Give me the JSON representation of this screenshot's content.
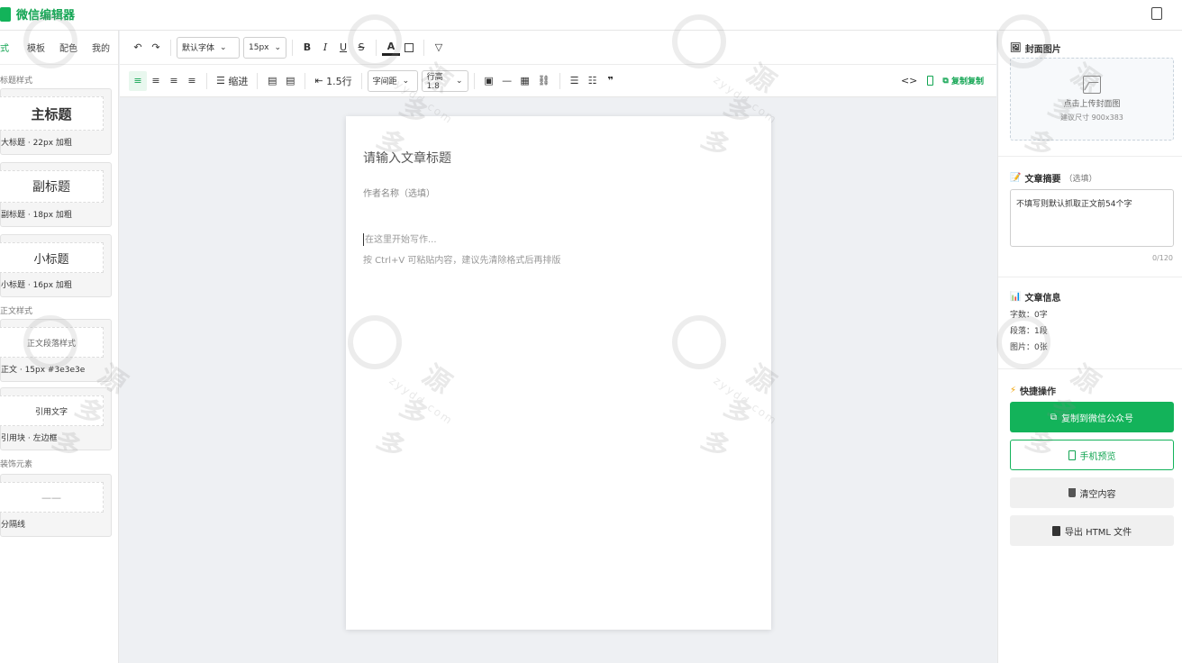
{
  "app": {
    "title": "微信编辑器"
  },
  "left_panel": {
    "tabs": [
      {
        "label": "式",
        "active": true
      },
      {
        "label": "模板"
      },
      {
        "label": "配色"
      },
      {
        "label": "我的"
      }
    ],
    "section_titles": [
      "标题样式",
      "正文样式",
      "装饰元素"
    ],
    "cards": [
      {
        "preview": "主标题",
        "caption": "大标题 · 22px 加粗"
      },
      {
        "preview": "副标题",
        "caption": "副标题 · 18px 加粗"
      },
      {
        "preview": "小标题",
        "caption": "小标题 · 16px 加粗"
      },
      {
        "preview": "正文段落样式",
        "caption": "正文 · 15px #3e3e3e"
      },
      {
        "preview": "引用文字",
        "caption": "引用块 · 左边框"
      },
      {
        "preview": "——",
        "caption": "分隔线"
      }
    ]
  },
  "toolbar1": {
    "undo": "↶",
    "redo": "↷",
    "font_family": "默认字体",
    "font_size": "15px",
    "bold": "B",
    "italic": "I",
    "underline": "U",
    "strike": "S",
    "text_color": "A"
  },
  "toolbar2": {
    "indent_label": "缩进",
    "line_break_label": "1.5行",
    "letter_spacing": "字间距",
    "line_height": "行高1.8",
    "copy_label": "复制复制",
    "code": "<>"
  },
  "editor": {
    "title_placeholder": "请输入文章标题",
    "author_placeholder": "作者名称（选填）",
    "body_placeholder": "在这里开始写作...",
    "tip": "按 Ctrl+V 可粘贴内容，建议先清除格式后再排版"
  },
  "right_panel": {
    "cover": {
      "title": "封面图片",
      "upload_text": "点击上传封面图",
      "size_hint": "建议尺寸 900x383"
    },
    "summary": {
      "title": "文章摘要",
      "optional": "（选填）",
      "placeholder": "不填写则默认抓取正文前54个字",
      "count": "0/120"
    },
    "info": {
      "title": "文章信息",
      "words": "字数：0字",
      "paragraphs": "段落：1段",
      "images": "图片：0张"
    },
    "actions": {
      "title": "快捷操作",
      "copy_wechat": "复制到微信公众号",
      "mobile_preview": "手机预览",
      "clear": "清空内容",
      "export_html": "导出 HTML 文件"
    }
  },
  "colors": {
    "accent": "#13b35a",
    "accent_text": "#13a553",
    "canvas_bg": "#eef0f3"
  },
  "watermark": {
    "text": "源多多",
    "sub": "zyydd.com"
  }
}
